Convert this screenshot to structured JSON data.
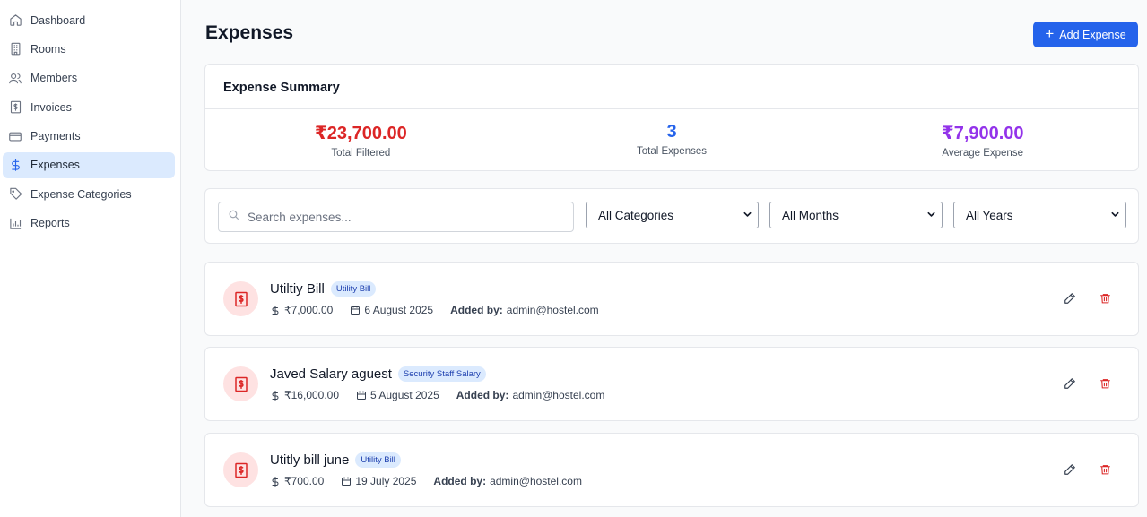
{
  "sidebar": {
    "items": [
      {
        "label": "Dashboard",
        "icon": "home-icon"
      },
      {
        "label": "Rooms",
        "icon": "building-icon"
      },
      {
        "label": "Members",
        "icon": "users-icon"
      },
      {
        "label": "Invoices",
        "icon": "receipt-icon"
      },
      {
        "label": "Payments",
        "icon": "credit-card-icon"
      },
      {
        "label": "Expenses",
        "icon": "dollar-icon",
        "active": true
      },
      {
        "label": "Expense Categories",
        "icon": "tag-icon"
      },
      {
        "label": "Reports",
        "icon": "bar-chart-icon"
      }
    ]
  },
  "header": {
    "title": "Expenses",
    "add_button": "Add Expense"
  },
  "summary": {
    "title": "Expense Summary",
    "stats": [
      {
        "value": "₹23,700.00",
        "label": "Total Filtered",
        "color": "#dc2626"
      },
      {
        "value": "3",
        "label": "Total Expenses",
        "color": "#2563eb"
      },
      {
        "value": "₹7,900.00",
        "label": "Average Expense",
        "color": "#9333ea"
      }
    ]
  },
  "filters": {
    "search_placeholder": "Search expenses...",
    "category": "All Categories",
    "month": "All Months",
    "year": "All Years"
  },
  "expenses": [
    {
      "title": "Utiltiy Bill",
      "category": "Utility Bill",
      "amount": "₹7,000.00",
      "date": "6 August 2025",
      "added_by_label": "Added by:",
      "added_by": "admin@hostel.com"
    },
    {
      "title": "Javed Salary aguest",
      "category": "Security Staff Salary",
      "amount": "₹16,000.00",
      "date": "5 August 2025",
      "added_by_label": "Added by:",
      "added_by": "admin@hostel.com"
    },
    {
      "title": "Utitly bill june",
      "category": "Utility Bill",
      "amount": "₹700.00",
      "date": "19 July 2025",
      "added_by_label": "Added by:",
      "added_by": "admin@hostel.com"
    }
  ],
  "colors": {
    "accent": "#2563eb",
    "danger": "#dc2626",
    "purple": "#9333ea",
    "active_nav_bg": "#dbeafe"
  }
}
